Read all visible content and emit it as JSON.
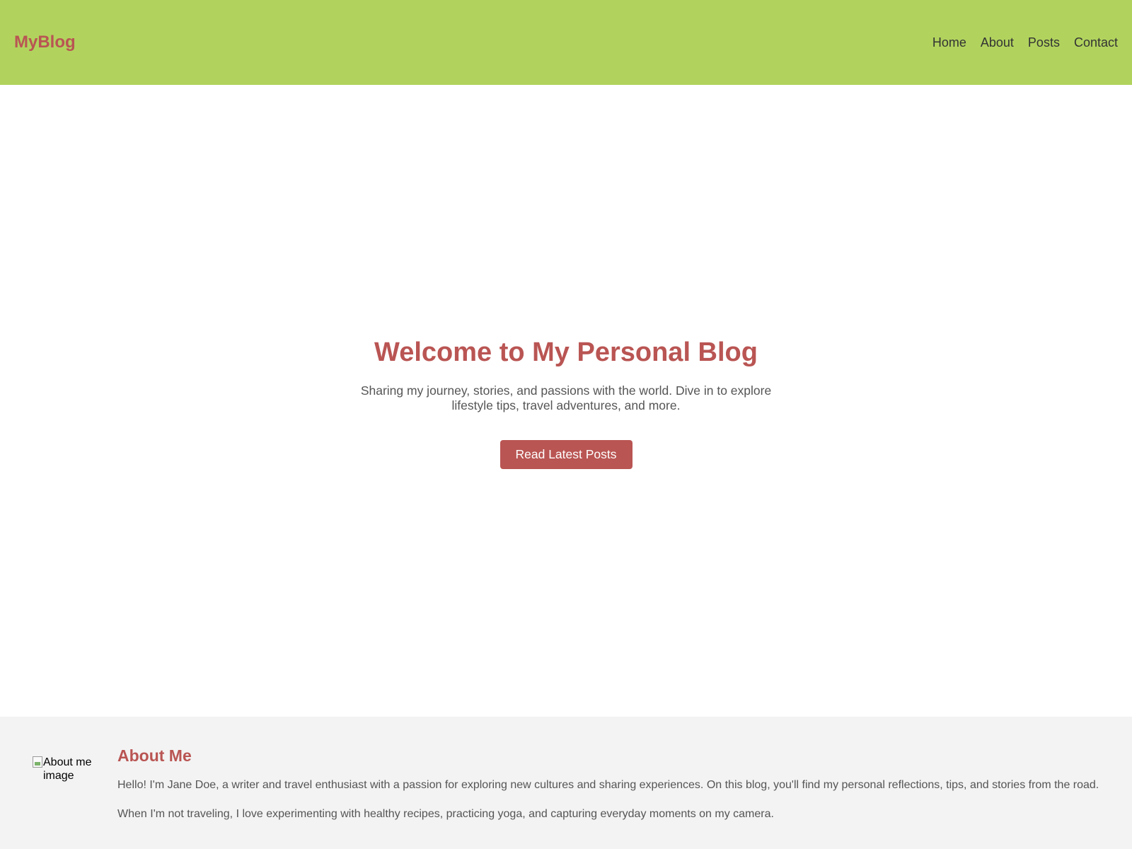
{
  "header": {
    "brand": "MyBlog",
    "nav": [
      {
        "label": "Home"
      },
      {
        "label": "About"
      },
      {
        "label": "Posts"
      },
      {
        "label": "Contact"
      }
    ]
  },
  "hero": {
    "title": "Welcome to My Personal Blog",
    "subtitle": "Sharing my journey, stories, and passions with the world. Dive in to explore lifestyle tips, travel adventures, and more.",
    "button_label": "Read Latest Posts"
  },
  "about": {
    "image_alt": "About me image",
    "title": "About Me",
    "paragraphs": [
      "Hello! I'm Jane Doe, a writer and travel enthusiast with a passion for exploring new cultures and sharing experiences. On this blog, you'll find my personal reflections, tips, and stories from the road.",
      "When I'm not traveling, I love experimenting with healthy recipes, practicing yoga, and capturing everyday moments on my camera."
    ]
  },
  "colors": {
    "header_bg": "#b1d35e",
    "accent": "#b95553",
    "about_bg": "#f3f3f3"
  }
}
